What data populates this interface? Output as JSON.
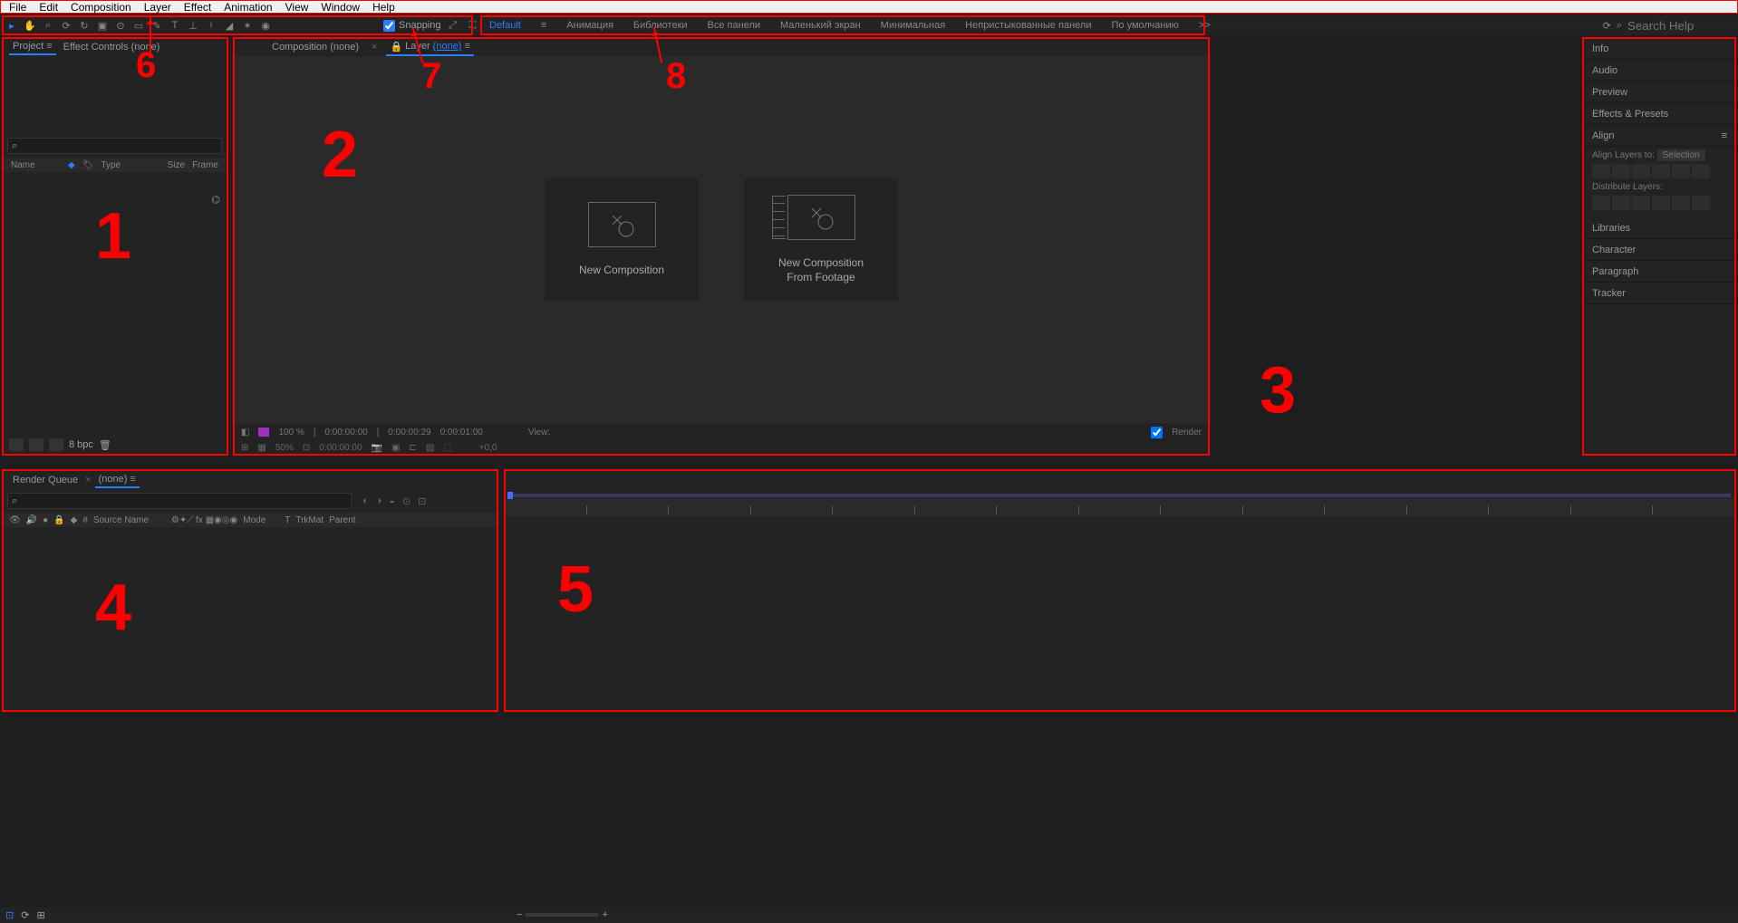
{
  "menu": [
    "File",
    "Edit",
    "Composition",
    "Layer",
    "Effect",
    "Animation",
    "View",
    "Window",
    "Help"
  ],
  "toolbar": {
    "snapping_label": "Snapping",
    "snapping_checked": true
  },
  "workspaces": {
    "default": "Default",
    "items": [
      "Анимация",
      "Библиотеки",
      "Все панели",
      "Маленький экран",
      "Минимальная",
      "Непристыкованные панели",
      "По умолчанию"
    ],
    "more": ">>"
  },
  "search_placeholder": "Search Help",
  "project": {
    "tab_project": "Project",
    "tab_effectcontrols": "Effect Controls (none)",
    "search_glyph": "⌕",
    "col_name": "Name",
    "col_type": "Type",
    "col_size": "Size",
    "col_frame": "Frame",
    "bpc": "8 bpc"
  },
  "comp": {
    "tab_composition": "Composition (none)",
    "tab_layer_prefix": "Layer",
    "tab_layer_link": "(none)",
    "new_comp": "New Composition",
    "new_comp_footage_l1": "New Composition",
    "new_comp_footage_l2": "From Footage",
    "footer_pct": "100 %",
    "footer_t1": "0:00:00:00",
    "footer_t2": "0:00:00:29",
    "footer_t3": "0:00:01:00",
    "footer_view": "View:",
    "footer_render": "Render",
    "footer2_zoom": "50%",
    "footer2_time": "0:00:00:00",
    "footer2_tail": "+0,0"
  },
  "right": {
    "info": "Info",
    "audio": "Audio",
    "preview": "Preview",
    "effects": "Effects & Presets",
    "align": "Align",
    "align_layers_to": "Align Layers to:",
    "align_sel": "Selection",
    "distribute": "Distribute Layers:",
    "libraries": "Libraries",
    "character": "Character",
    "paragraph": "Paragraph",
    "tracker": "Tracker"
  },
  "rq": {
    "tab_rq": "Render Queue",
    "tab_none": "(none)",
    "search_glyph": "⌕",
    "c_hash": "#",
    "c_source": "Source Name",
    "c_mode": "Mode",
    "c_t": "T",
    "c_trkmat": "TrkMat",
    "c_parent": "Parent"
  },
  "annotations": {
    "n1": "1",
    "n2": "2",
    "n3": "3",
    "n4": "4",
    "n5": "5",
    "n6": "6",
    "n7": "7",
    "n8": "8"
  }
}
